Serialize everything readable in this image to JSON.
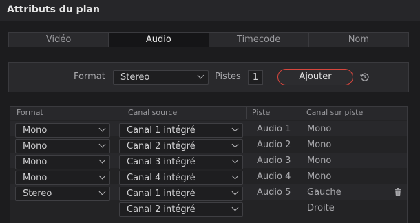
{
  "window": {
    "title": "Attributs du plan"
  },
  "tabs": [
    {
      "label": "Vidéo",
      "active": false
    },
    {
      "label": "Audio",
      "active": true
    },
    {
      "label": "Timecode",
      "active": false
    },
    {
      "label": "Nom",
      "active": false
    }
  ],
  "format_panel": {
    "format_label": "Format",
    "format_value": "Stereo",
    "tracks_label": "Pistes",
    "tracks_value": "1",
    "add_button": "Ajouter"
  },
  "table": {
    "headers": {
      "format": "Format",
      "source": "Canal source",
      "track": "Piste",
      "channel": "Canal sur piste"
    },
    "rows": [
      {
        "format": "Mono",
        "source": "Canal 1 intégré",
        "track": "Audio 1",
        "channel": "Mono"
      },
      {
        "format": "Mono",
        "source": "Canal 2 intégré",
        "track": "Audio 2",
        "channel": "Mono"
      },
      {
        "format": "Mono",
        "source": "Canal 3 intégré",
        "track": "Audio 3",
        "channel": "Mono"
      },
      {
        "format": "Mono",
        "source": "Canal 4 intégré",
        "track": "Audio 4",
        "channel": "Mono"
      },
      {
        "format": "Stereo",
        "source": "Canal 1 intégré",
        "track": "Audio 5",
        "channel": "Gauche"
      },
      {
        "format": "",
        "source": "Canal 2 intégré",
        "track": "",
        "channel": "Droite"
      }
    ]
  },
  "colors": {
    "accent": "#d8463d"
  }
}
